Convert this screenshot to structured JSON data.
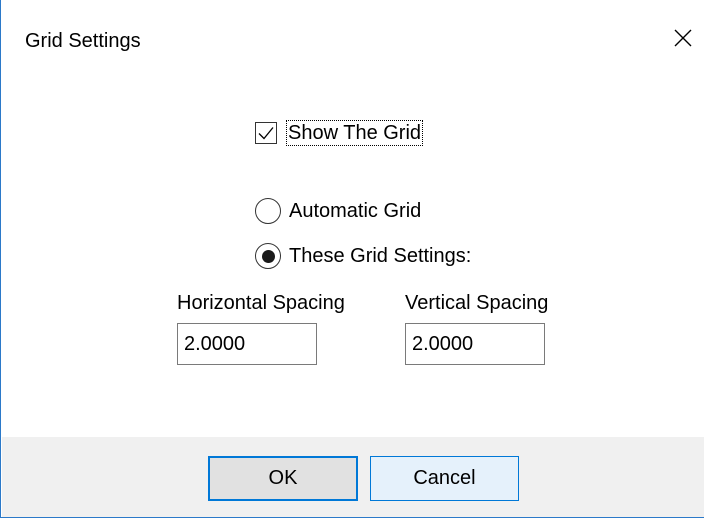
{
  "window": {
    "title": "Grid Settings",
    "close_icon": "close-icon"
  },
  "show_grid": {
    "label": "Show The Grid",
    "checked": true
  },
  "grid_mode": {
    "options": [
      {
        "label": "Automatic Grid",
        "selected": false
      },
      {
        "label": "These Grid Settings:",
        "selected": true
      }
    ]
  },
  "spacing": {
    "horizontal_label": "Horizontal Spacing",
    "horizontal_value": "2.0000",
    "vertical_label": "Vertical Spacing",
    "vertical_value": "2.0000"
  },
  "buttons": {
    "ok_label": "OK",
    "cancel_label": "Cancel"
  },
  "colors": {
    "accent": "#0078d7",
    "footer_bg": "#f0f0f0",
    "window_border": "#2b79c9"
  }
}
